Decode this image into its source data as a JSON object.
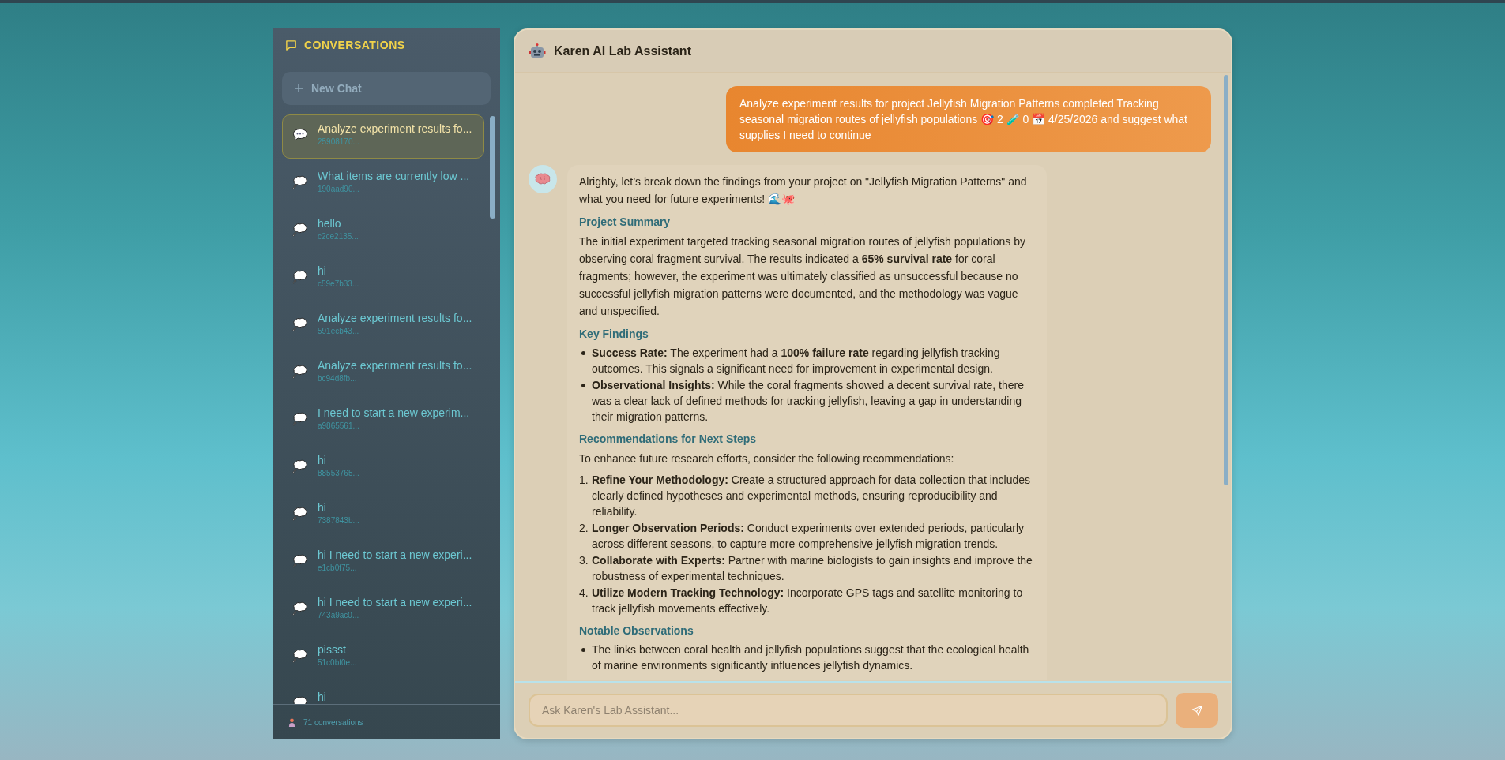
{
  "sidebar": {
    "title": "CONVERSATIONS",
    "new_chat": "New Chat",
    "conversations": [
      {
        "title": "Analyze experiment results fo...",
        "id": "25908170...",
        "selected": true
      },
      {
        "title": "What items are currently low ...",
        "id": "190aad90...",
        "selected": false
      },
      {
        "title": "hello",
        "id": "c2ce2135...",
        "selected": false
      },
      {
        "title": "hi",
        "id": "c59e7b33...",
        "selected": false
      },
      {
        "title": "Analyze experiment results fo...",
        "id": "591ecb43...",
        "selected": false
      },
      {
        "title": "Analyze experiment results fo...",
        "id": "bc94d8fb...",
        "selected": false
      },
      {
        "title": "I need to start a new experim...",
        "id": "a9865561...",
        "selected": false
      },
      {
        "title": "hi",
        "id": "88553765...",
        "selected": false
      },
      {
        "title": "hi",
        "id": "7387843b...",
        "selected": false
      },
      {
        "title": "hi I need to start a new experi...",
        "id": "e1cb0f75...",
        "selected": false
      },
      {
        "title": "hi I need to start a new experi...",
        "id": "743a9ac0...",
        "selected": false
      },
      {
        "title": "pissst",
        "id": "51c0bf0e...",
        "selected": false
      },
      {
        "title": "hi",
        "selected": false
      }
    ],
    "footer": "71 conversations"
  },
  "chat": {
    "title": "Karen AI Lab Assistant",
    "messages": [
      {
        "kind": "user",
        "text": "Analyze experiment results for project Jellyfish Migration Patterns completed Tracking seasonal migration routes of jellyfish populations  🎯 2 🧪 0 📅 4/25/2026 and suggest what supplies I need to continue"
      },
      {
        "kind": "assistant",
        "blocks": [
          {
            "kind": "paragraph",
            "text": "Alrighty, let’s break down the findings from your project on \"Jellyfish Migration Patterns\" and what you need for future experiments! 🌊🐙"
          },
          {
            "kind": "heading",
            "text": "Project Summary"
          },
          {
            "kind": "paragraph",
            "text": "The initial experiment targeted tracking seasonal migration routes of jellyfish populations by observing coral fragment survival. The results indicated a **65% survival rate** for coral fragments; however, the experiment was ultimately classified as unsuccessful because no successful jellyfish migration patterns were documented, and the methodology was vague and unspecified."
          },
          {
            "kind": "heading",
            "text": "Key Findings"
          },
          {
            "kind": "bullets",
            "items": [
              "**Success Rate:** The experiment had a **100% failure rate** regarding jellyfish tracking outcomes. This signals a significant need for improvement in experimental design.",
              "**Observational Insights:** While the coral fragments showed a decent survival rate, there was a clear lack of defined methods for tracking jellyfish, leaving a gap in understanding their migration patterns."
            ]
          },
          {
            "kind": "heading",
            "text": "Recommendations for Next Steps"
          },
          {
            "kind": "paragraph",
            "text": "To enhance future research efforts, consider the following recommendations:"
          },
          {
            "kind": "numbered",
            "items": [
              {
                "number": "1.",
                "text": "**Refine Your Methodology:** Create a structured approach for data collection that includes clearly defined hypotheses and experimental methods, ensuring reproducibility and reliability."
              },
              {
                "number": "2.",
                "text": "**Longer Observation Periods:** Conduct experiments over extended periods, particularly across different seasons, to capture more comprehensive jellyfish migration trends."
              },
              {
                "number": "3.",
                "text": "**Collaborate with Experts:** Partner with marine biologists to gain insights and improve the robustness of experimental techniques."
              },
              {
                "number": "4.",
                "text": "**Utilize Modern Tracking Technology:** Incorporate GPS tags and satellite monitoring to track jellyfish movements effectively."
              }
            ]
          },
          {
            "kind": "heading",
            "text": "Notable Observations"
          },
          {
            "kind": "bullets",
            "items": [
              "The links between coral health and jellyfish populations suggest that the ecological health of marine environments significantly influences jellyfish dynamics."
            ]
          }
        ]
      }
    ]
  },
  "input": {
    "placeholder": "Ask Karen's Lab Assistant..."
  }
}
